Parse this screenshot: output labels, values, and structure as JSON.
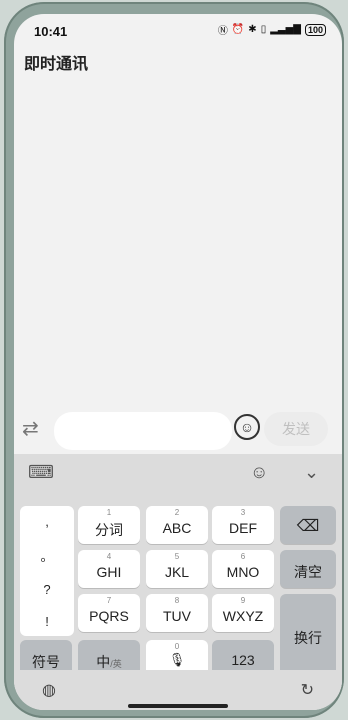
{
  "status": {
    "time": "10:41",
    "battery": "100"
  },
  "app": {
    "title": "即时通讯"
  },
  "input": {
    "placeholder": "",
    "send_label": "发送"
  },
  "keyboard": {
    "punct": [
      ",",
      "。",
      "?",
      "!"
    ],
    "keys": [
      {
        "num": "1",
        "label": "分词"
      },
      {
        "num": "2",
        "label": "ABC"
      },
      {
        "num": "3",
        "label": "DEF"
      },
      {
        "num": "4",
        "label": "GHI"
      },
      {
        "num": "5",
        "label": "JKL"
      },
      {
        "num": "6",
        "label": "MNO"
      },
      {
        "num": "7",
        "label": "PQRS"
      },
      {
        "num": "8",
        "label": "TUV"
      },
      {
        "num": "9",
        "label": "WXYZ"
      }
    ],
    "clear_label": "清空",
    "enter_label": "换行",
    "symbols_label": "符号",
    "lang_label": "中",
    "lang_sub": "/英",
    "space_num": "0",
    "num_label": "123"
  }
}
